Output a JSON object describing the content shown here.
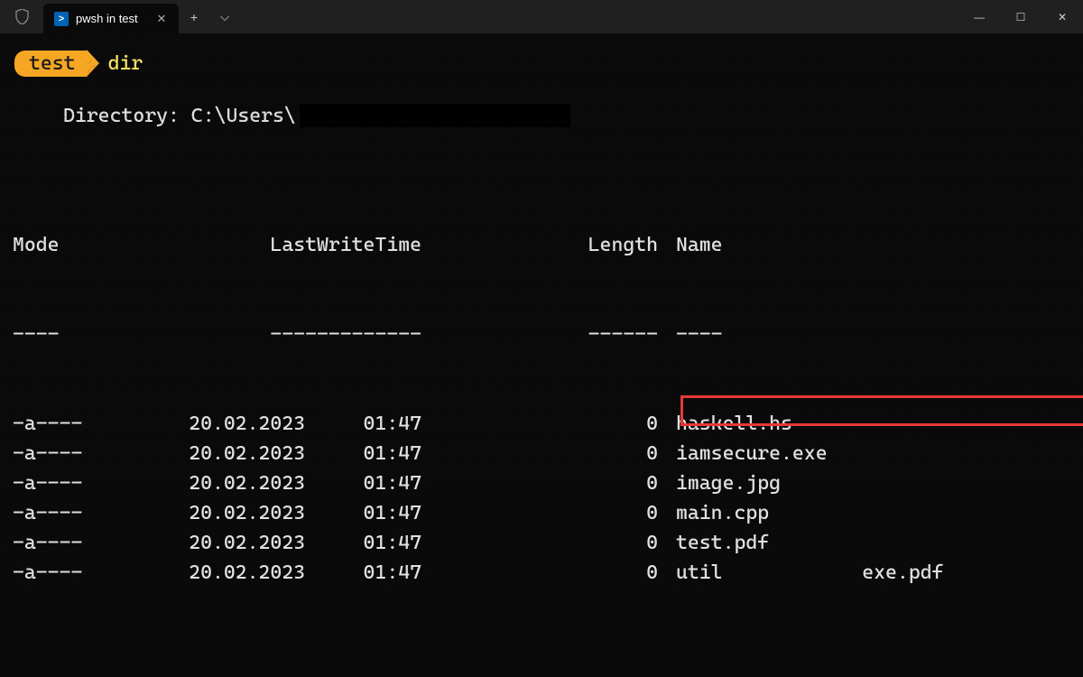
{
  "titlebar": {
    "tab_title": "pwsh in test",
    "tab_icon_glyph": ">",
    "close_glyph": "✕",
    "new_tab_glyph": "+",
    "dropdown_glyph": "⌵",
    "minimize_glyph": "—",
    "maximize_glyph": "☐",
    "win_close_glyph": "✕"
  },
  "prompt": {
    "location": "test",
    "command": "dir"
  },
  "directory_label": "Directory: C:\\Users\\",
  "headers": {
    "mode": "Mode",
    "lwt": "LastWriteTime",
    "len": "Length",
    "name": "Name",
    "sep_mode": "----",
    "sep_lwt": "-------------",
    "sep_len": "------",
    "sep_name": "----"
  },
  "rows": [
    {
      "mode": "-a----",
      "date": "20.02.2023",
      "time": "01:47",
      "length": "0",
      "name": "haskell.hs"
    },
    {
      "mode": "-a----",
      "date": "20.02.2023",
      "time": "01:47",
      "length": "0",
      "name": "iamsecure.exe"
    },
    {
      "mode": "-a----",
      "date": "20.02.2023",
      "time": "01:47",
      "length": "0",
      "name": "image.jpg"
    },
    {
      "mode": "-a----",
      "date": "20.02.2023",
      "time": "01:47",
      "length": "0",
      "name": "main.cpp"
    },
    {
      "mode": "-a----",
      "date": "20.02.2023",
      "time": "01:47",
      "length": "0",
      "name": "test.pdf"
    },
    {
      "mode": "-a----",
      "date": "20.02.2023",
      "time": "01:47",
      "length": "0",
      "name": "util            exe.pdf"
    }
  ]
}
